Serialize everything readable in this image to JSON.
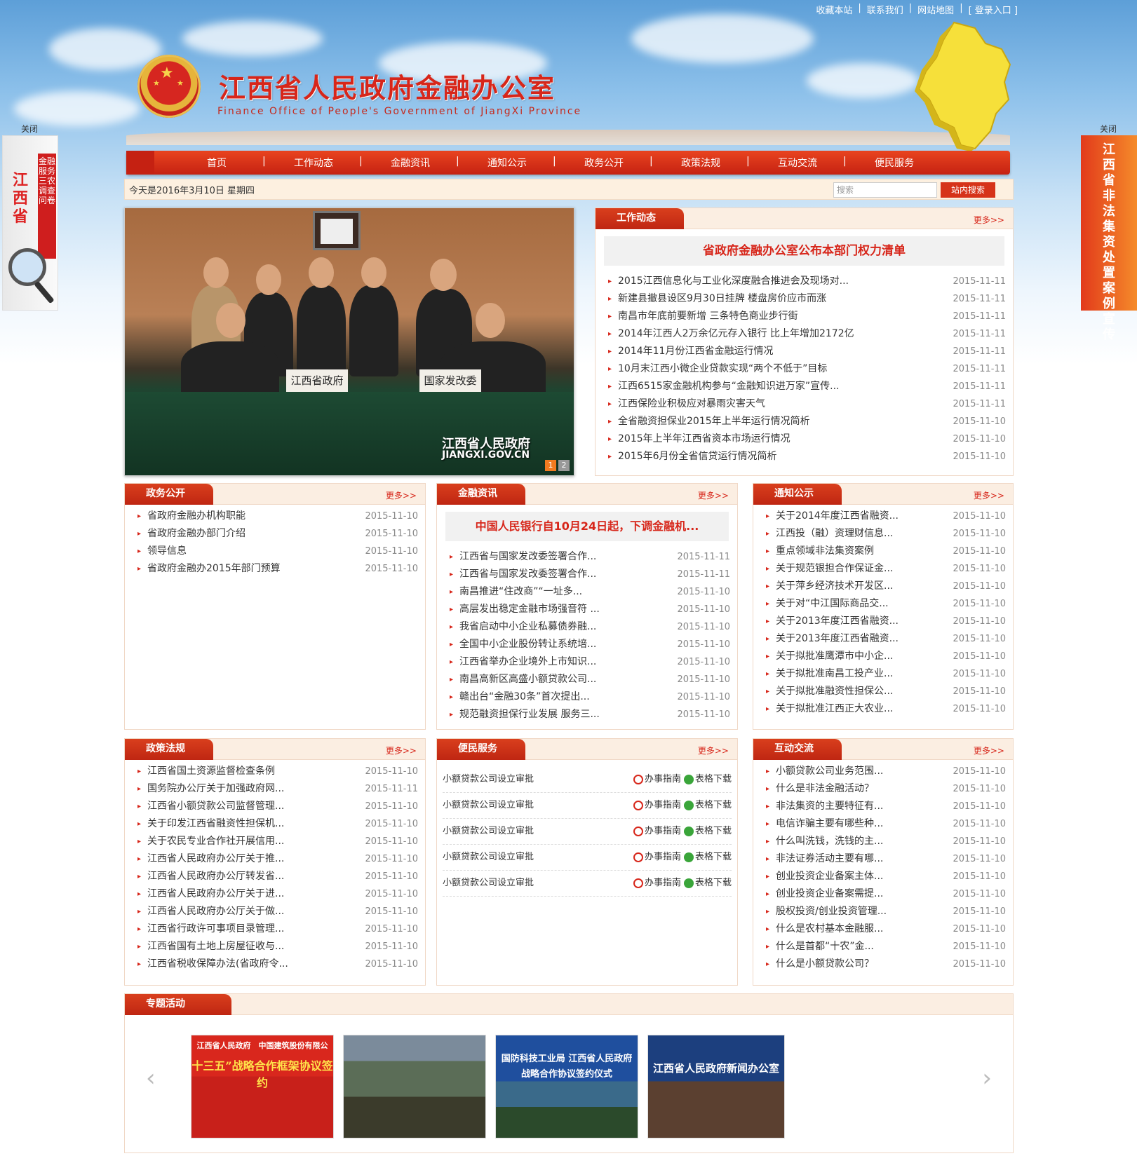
{
  "toplinks": {
    "fav": "收藏本站",
    "contact": "联系我们",
    "sitemap": "网站地图",
    "login": "[ 登录入口 ]"
  },
  "header": {
    "title_cn": "江西省人民政府金融办公室",
    "title_en": "Finance Office of People's Government of JiangXi Province"
  },
  "nav": [
    "首页",
    "工作动态",
    "金融资讯",
    "通知公示",
    "政务公开",
    "政策法规",
    "互动交流",
    "便民服务"
  ],
  "datebar": {
    "today": "今天是2016年3月10日 星期四",
    "search_placeholder": "搜索",
    "search_button": "站内搜索"
  },
  "side": {
    "close_left": "关闭",
    "close_right": "关闭",
    "left_big": "江西省",
    "left_strip": "金融服务三农调查问卷",
    "right_text": "江西省非法集资处置案例宣传"
  },
  "slider": {
    "plate_left": "江西省政府",
    "plate_right": "国家发改委",
    "watermark": "江西省人民政府",
    "watermark_url": "JIANGXI.GOV.CN",
    "dots": [
      "1",
      "2"
    ]
  },
  "more_label": "更多>>",
  "work": {
    "title": "工作动态",
    "headline": "省政府金融办公室公布本部门权力清单",
    "items": [
      {
        "t": "2015江西信息化与工业化深度融合推进会及现场对...",
        "d": "2015-11-11"
      },
      {
        "t": "新建县撤县设区9月30日挂牌 楼盘房价应市而涨",
        "d": "2015-11-11"
      },
      {
        "t": "南昌市年底前要新增 三条特色商业步行街",
        "d": "2015-11-11"
      },
      {
        "t": "2014年江西人2万余亿元存入银行 比上年增加2172亿",
        "d": "2015-11-11"
      },
      {
        "t": "2014年11月份江西省金融运行情况",
        "d": "2015-11-11"
      },
      {
        "t": "10月末江西小微企业贷款实现“两个不低于”目标",
        "d": "2015-11-11"
      },
      {
        "t": "江西6515家金融机构参与“金融知识进万家”宣传...",
        "d": "2015-11-11"
      },
      {
        "t": "江西保险业积极应对暴雨灾害天气",
        "d": "2015-11-11"
      },
      {
        "t": "全省融资担保业2015年上半年运行情况简析",
        "d": "2015-11-10"
      },
      {
        "t": "2015年上半年江西省资本市场运行情况",
        "d": "2015-11-10"
      },
      {
        "t": "2015年6月份全省信贷运行情况简析",
        "d": "2015-11-10"
      }
    ]
  },
  "gov": {
    "title": "政务公开",
    "items": [
      {
        "t": "省政府金融办机构职能",
        "d": "2015-11-10"
      },
      {
        "t": "省政府金融办部门介绍",
        "d": "2015-11-10"
      },
      {
        "t": "领导信息",
        "d": "2015-11-10"
      },
      {
        "t": "省政府金融办2015年部门预算",
        "d": "2015-11-10"
      }
    ]
  },
  "finance": {
    "title": "金融资讯",
    "headline": "中国人民银行自10月24日起，下调金融机...",
    "items": [
      {
        "t": "江西省与国家发改委签署合作...",
        "d": "2015-11-11"
      },
      {
        "t": "江西省与国家发改委签署合作...",
        "d": "2015-11-11"
      },
      {
        "t": "南昌推进“住改商”“一址多...",
        "d": "2015-11-10"
      },
      {
        "t": "高层发出稳定金融市场强音符 ...",
        "d": "2015-11-10"
      },
      {
        "t": "我省启动中小企业私募债券融...",
        "d": "2015-11-10"
      },
      {
        "t": "全国中小企业股份转让系统培...",
        "d": "2015-11-10"
      },
      {
        "t": "江西省举办企业境外上市知识...",
        "d": "2015-11-10"
      },
      {
        "t": "南昌高新区高盛小额贷款公司...",
        "d": "2015-11-10"
      },
      {
        "t": "赣出台“金融30条”首次提出...",
        "d": "2015-11-10"
      },
      {
        "t": "规范融资担保行业发展 服务三...",
        "d": "2015-11-10"
      }
    ]
  },
  "notice": {
    "title": "通知公示",
    "items": [
      {
        "t": "关于2014年度江西省融资...",
        "d": "2015-11-10"
      },
      {
        "t": "江西投（融）资理财信息...",
        "d": "2015-11-10"
      },
      {
        "t": "重点领域非法集资案例",
        "d": "2015-11-10"
      },
      {
        "t": "关于规范银担合作保证金...",
        "d": "2015-11-10"
      },
      {
        "t": "关于萍乡经济技术开发区...",
        "d": "2015-11-10"
      },
      {
        "t": "关于对“中江国际商品交...",
        "d": "2015-11-10"
      },
      {
        "t": "关于2013年度江西省融资...",
        "d": "2015-11-10"
      },
      {
        "t": "关于2013年度江西省融资...",
        "d": "2015-11-10"
      },
      {
        "t": "关于拟批准鹰潭市中小企...",
        "d": "2015-11-10"
      },
      {
        "t": "关于拟批准南昌工投产业...",
        "d": "2015-11-10"
      },
      {
        "t": "关于拟批准融资性担保公...",
        "d": "2015-11-10"
      },
      {
        "t": "关于拟批准江西正大农业...",
        "d": "2015-11-10"
      }
    ]
  },
  "policy": {
    "title": "政策法规",
    "items": [
      {
        "t": "江西省国土资源监督检查条例",
        "d": "2015-11-10"
      },
      {
        "t": "国务院办公厅关于加强政府网...",
        "d": "2015-11-11"
      },
      {
        "t": "江西省小额贷款公司监督管理...",
        "d": "2015-11-10"
      },
      {
        "t": "关于印发江西省融资性担保机...",
        "d": "2015-11-10"
      },
      {
        "t": "关于农民专业合作社开展信用...",
        "d": "2015-11-10"
      },
      {
        "t": "江西省人民政府办公厅关于推...",
        "d": "2015-11-10"
      },
      {
        "t": "江西省人民政府办公厅转发省...",
        "d": "2015-11-10"
      },
      {
        "t": "江西省人民政府办公厅关于进...",
        "d": "2015-11-10"
      },
      {
        "t": "江西省人民政府办公厅关于做...",
        "d": "2015-11-10"
      },
      {
        "t": "江西省行政许可事项目录管理...",
        "d": "2015-11-10"
      },
      {
        "t": "江西省国有土地上房屋征收与...",
        "d": "2015-11-10"
      },
      {
        "t": "江西省税收保障办法(省政府令...",
        "d": "2015-11-10"
      }
    ]
  },
  "service": {
    "title": "便民服务",
    "guide_label": "办事指南",
    "download_label": "表格下载",
    "items": [
      "小额贷款公司设立审批",
      "小额贷款公司设立审批",
      "小额贷款公司设立审批",
      "小额贷款公司设立审批",
      "小额贷款公司设立审批"
    ]
  },
  "interact": {
    "title": "互动交流",
    "items": [
      {
        "t": "小额贷款公司业务范围...",
        "d": "2015-11-10"
      },
      {
        "t": "什么是非法金融活动？",
        "d": "2015-11-10"
      },
      {
        "t": "非法集资的主要特征有...",
        "d": "2015-11-10"
      },
      {
        "t": "电信诈骗主要有哪些种...",
        "d": "2015-11-10"
      },
      {
        "t": "什么叫洗钱，洗钱的主...",
        "d": "2015-11-10"
      },
      {
        "t": "非法证券活动主要有哪...",
        "d": "2015-11-10"
      },
      {
        "t": "创业投资企业备案主体...",
        "d": "2015-11-10"
      },
      {
        "t": "创业投资企业备案需提...",
        "d": "2015-11-10"
      },
      {
        "t": "股权投资/创业投资管理...",
        "d": "2015-11-10"
      },
      {
        "t": "什么是农村基本金融服...",
        "d": "2015-11-10"
      },
      {
        "t": "什么是首都“十农”金...",
        "d": "2015-11-10"
      },
      {
        "t": "什么是小额贷款公司？",
        "d": "2015-11-10"
      }
    ]
  },
  "special": {
    "title": "专题活动",
    "thumbs": [
      {
        "cap1": "江西省人民政府　中国建筑股份有限公",
        "cap2": "十三五”战略合作框架协议签约"
      },
      {
        "cap1": "",
        "cap2": ""
      },
      {
        "cap1": "国防科技工业局 江西省人民政府",
        "cap2": "战略合作协议签约仪式"
      },
      {
        "cap1": "江西省人民政府新闻办公室",
        "cap2": ""
      }
    ]
  },
  "colors": {
    "brand_red": "#d7261a",
    "nav_red": "#c52112",
    "panel_bg": "#fbeee2"
  }
}
